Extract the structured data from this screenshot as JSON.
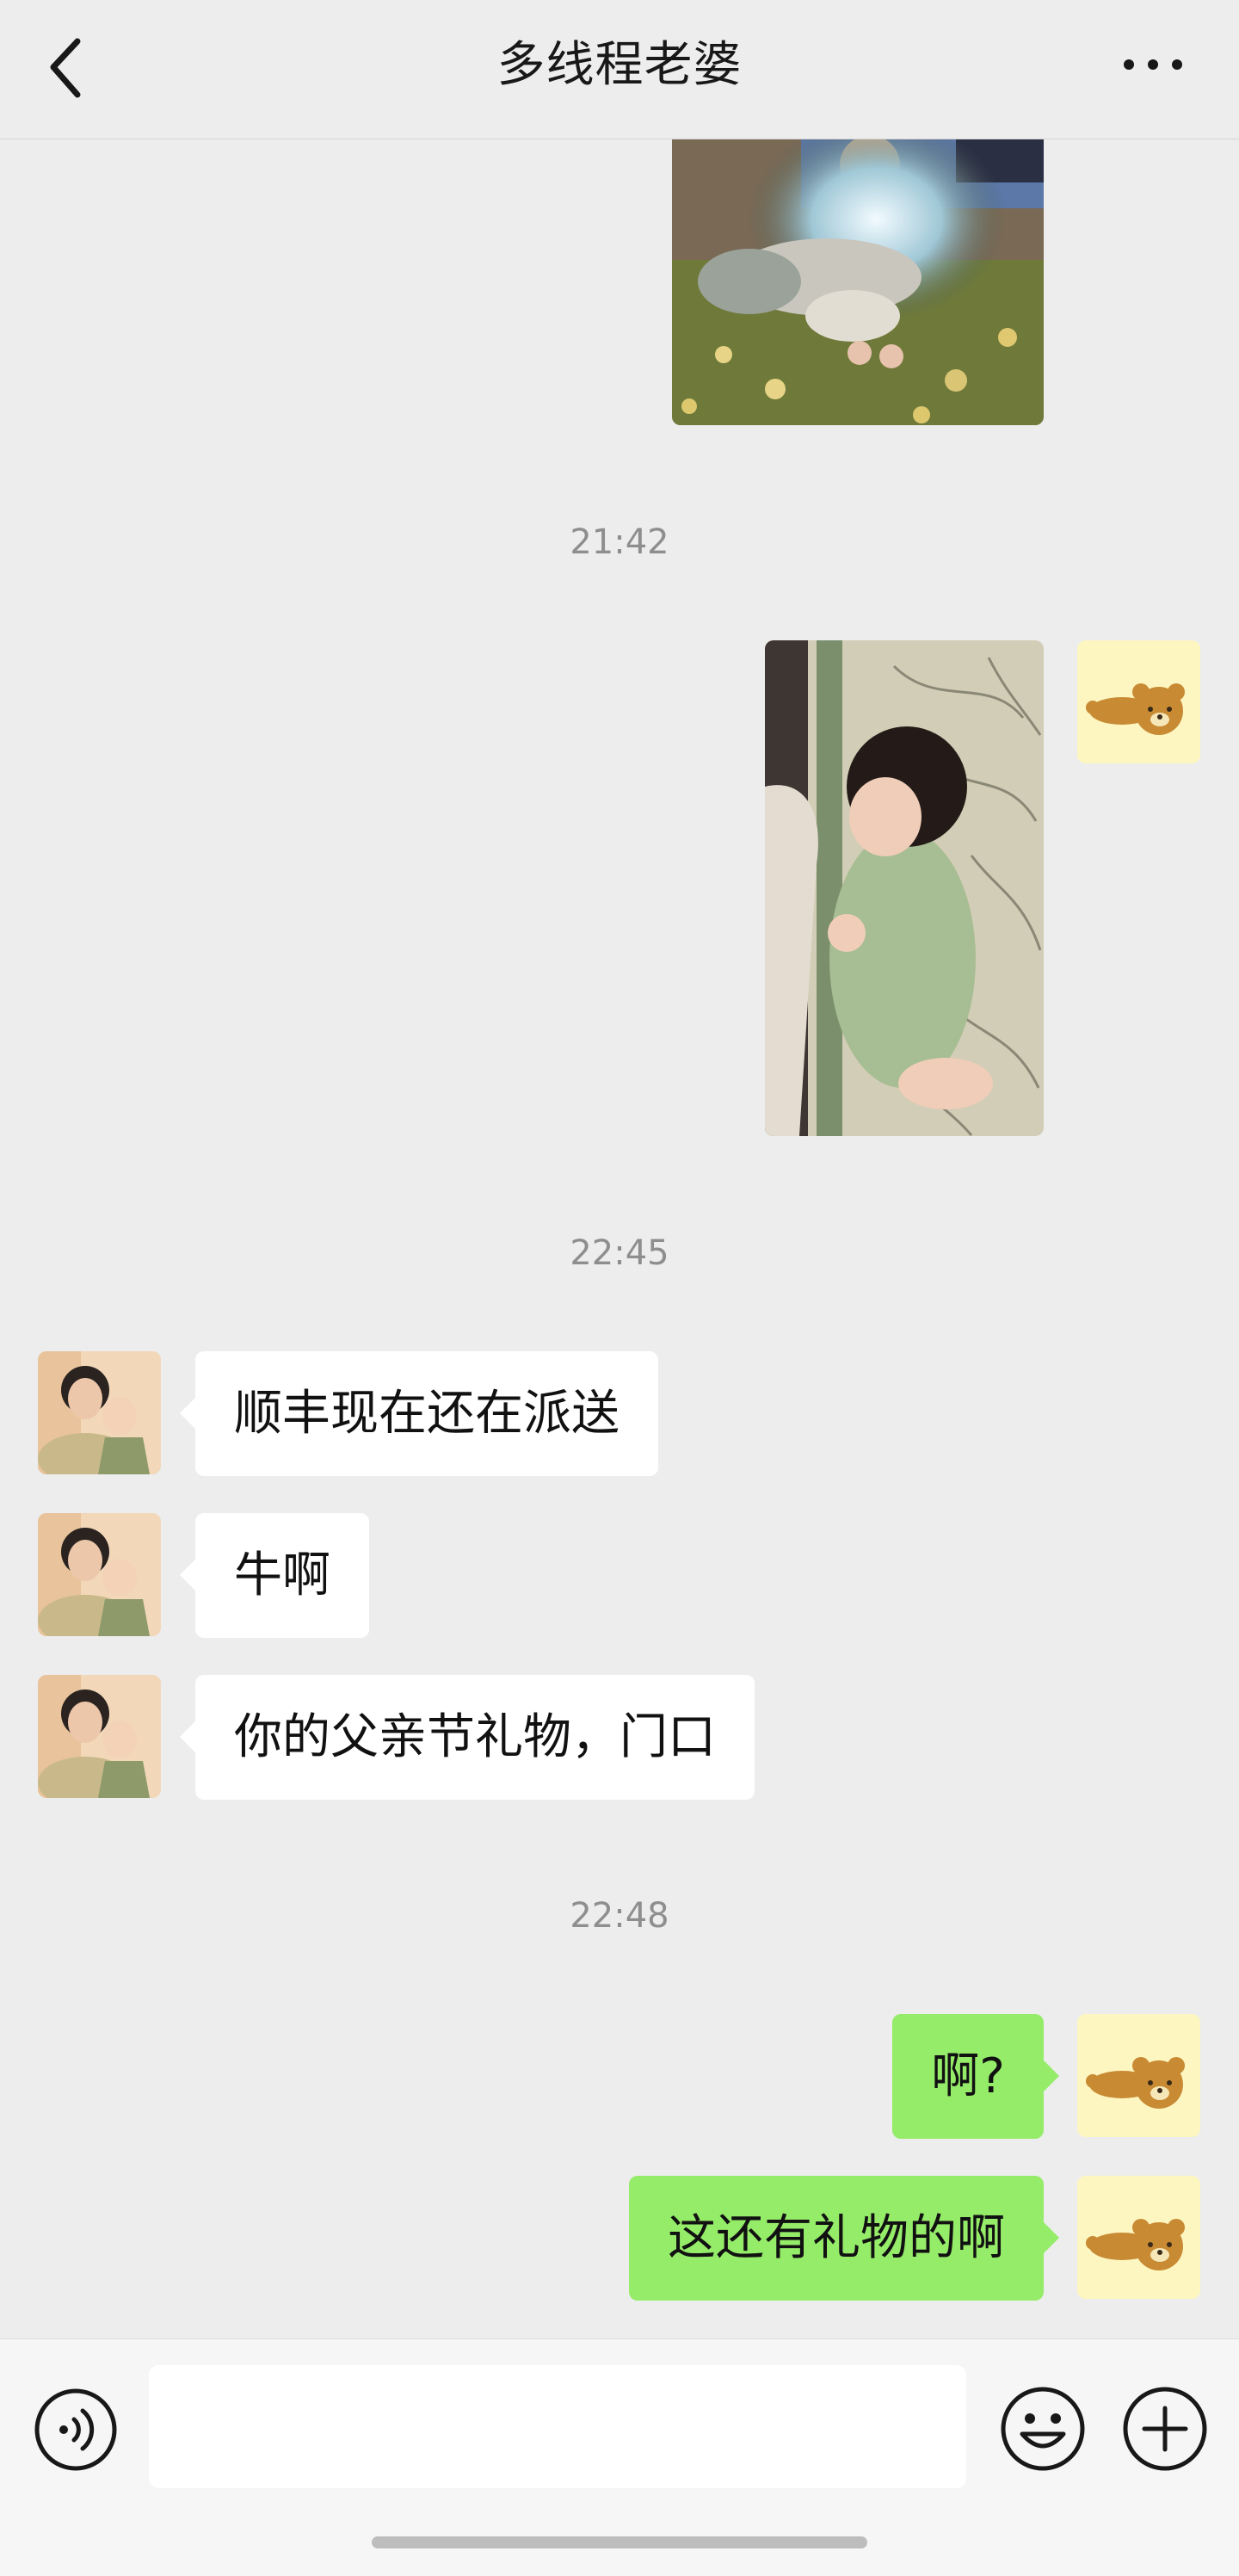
{
  "header": {
    "title": "多线程老婆",
    "back_icon": "chevron-left-icon",
    "more_icon": "more-dots-icon"
  },
  "messages": {
    "time_1": "21:42",
    "time_2": "22:45",
    "time_3": "22:48",
    "wife_1": "顺丰现在还在派送",
    "wife_2": "牛啊",
    "wife_3": "你的父亲节礼物，门口",
    "me_1": "啊?",
    "me_2": "这还有礼物的啊"
  },
  "input_bar": {
    "voice_icon": "voice-icon",
    "emoji_icon": "emoji-icon",
    "plus_icon": "plus-icon",
    "placeholder": ""
  },
  "colors": {
    "background": "#ededed",
    "self_bubble": "#95ec69",
    "other_bubble": "#ffffff",
    "timestamp": "#8e8e8e"
  }
}
